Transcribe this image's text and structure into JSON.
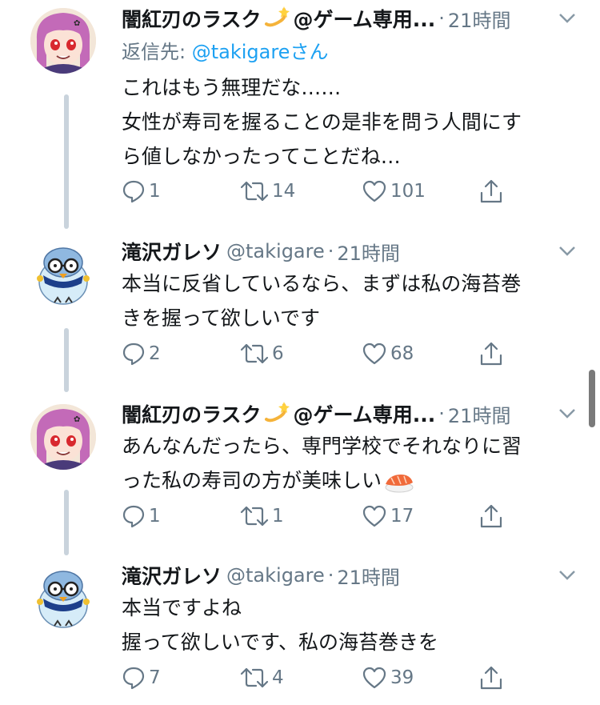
{
  "tweets": [
    {
      "name": "闇紅刃のラスク",
      "handle_suffix": "@ゲーム専用...",
      "handle": "",
      "time": "21時間",
      "reply_prefix": "返信先: ",
      "reply_user": "@takigare",
      "reply_suffix": "さん",
      "lines": [
        "これはもう無理だな……",
        "女性が寿司を握ることの是非を問う人間にす",
        "ら値しなかったってことだね…"
      ],
      "reply_count": "1",
      "retweet_count": "14",
      "like_count": "101",
      "avatar": "rusk-avatar"
    },
    {
      "name": "滝沢ガレソ",
      "handle": "@takigare",
      "time": "21時間",
      "lines": [
        "本当に反省しているなら、まずは私の海苔巻",
        "きを握って欲しいです"
      ],
      "reply_count": "2",
      "retweet_count": "6",
      "like_count": "68",
      "avatar": "bird-avatar"
    },
    {
      "name": "闇紅刃のラスク",
      "handle_suffix": "@ゲーム専用...",
      "time": "21時間",
      "lines": [
        "あんなんだったら、専門学校でそれなりに習",
        "った私の寿司の方が美味しい"
      ],
      "reply_count": "1",
      "retweet_count": "1",
      "like_count": "17",
      "avatar": "rusk-avatar"
    },
    {
      "name": "滝沢ガレソ",
      "handle": "@takigare",
      "time": "21時間",
      "lines": [
        "本当ですよね",
        "握って欲しいです、私の海苔巻きを"
      ],
      "reply_count": "7",
      "retweet_count": "4",
      "like_count": "39",
      "avatar": "bird-avatar"
    }
  ],
  "icons": {
    "reply": "reply-icon",
    "retweet": "retweet-icon",
    "like": "heart-icon",
    "share": "share-icon",
    "caret": "chevron-down-icon",
    "emoji_dash": "dizzy-emoji-icon",
    "emoji_sushi": "sushi-emoji-icon"
  },
  "colors": {
    "text": "#14171a",
    "secondary": "#657786",
    "link": "#1da1f2",
    "thread_line": "#c9d3dc"
  }
}
